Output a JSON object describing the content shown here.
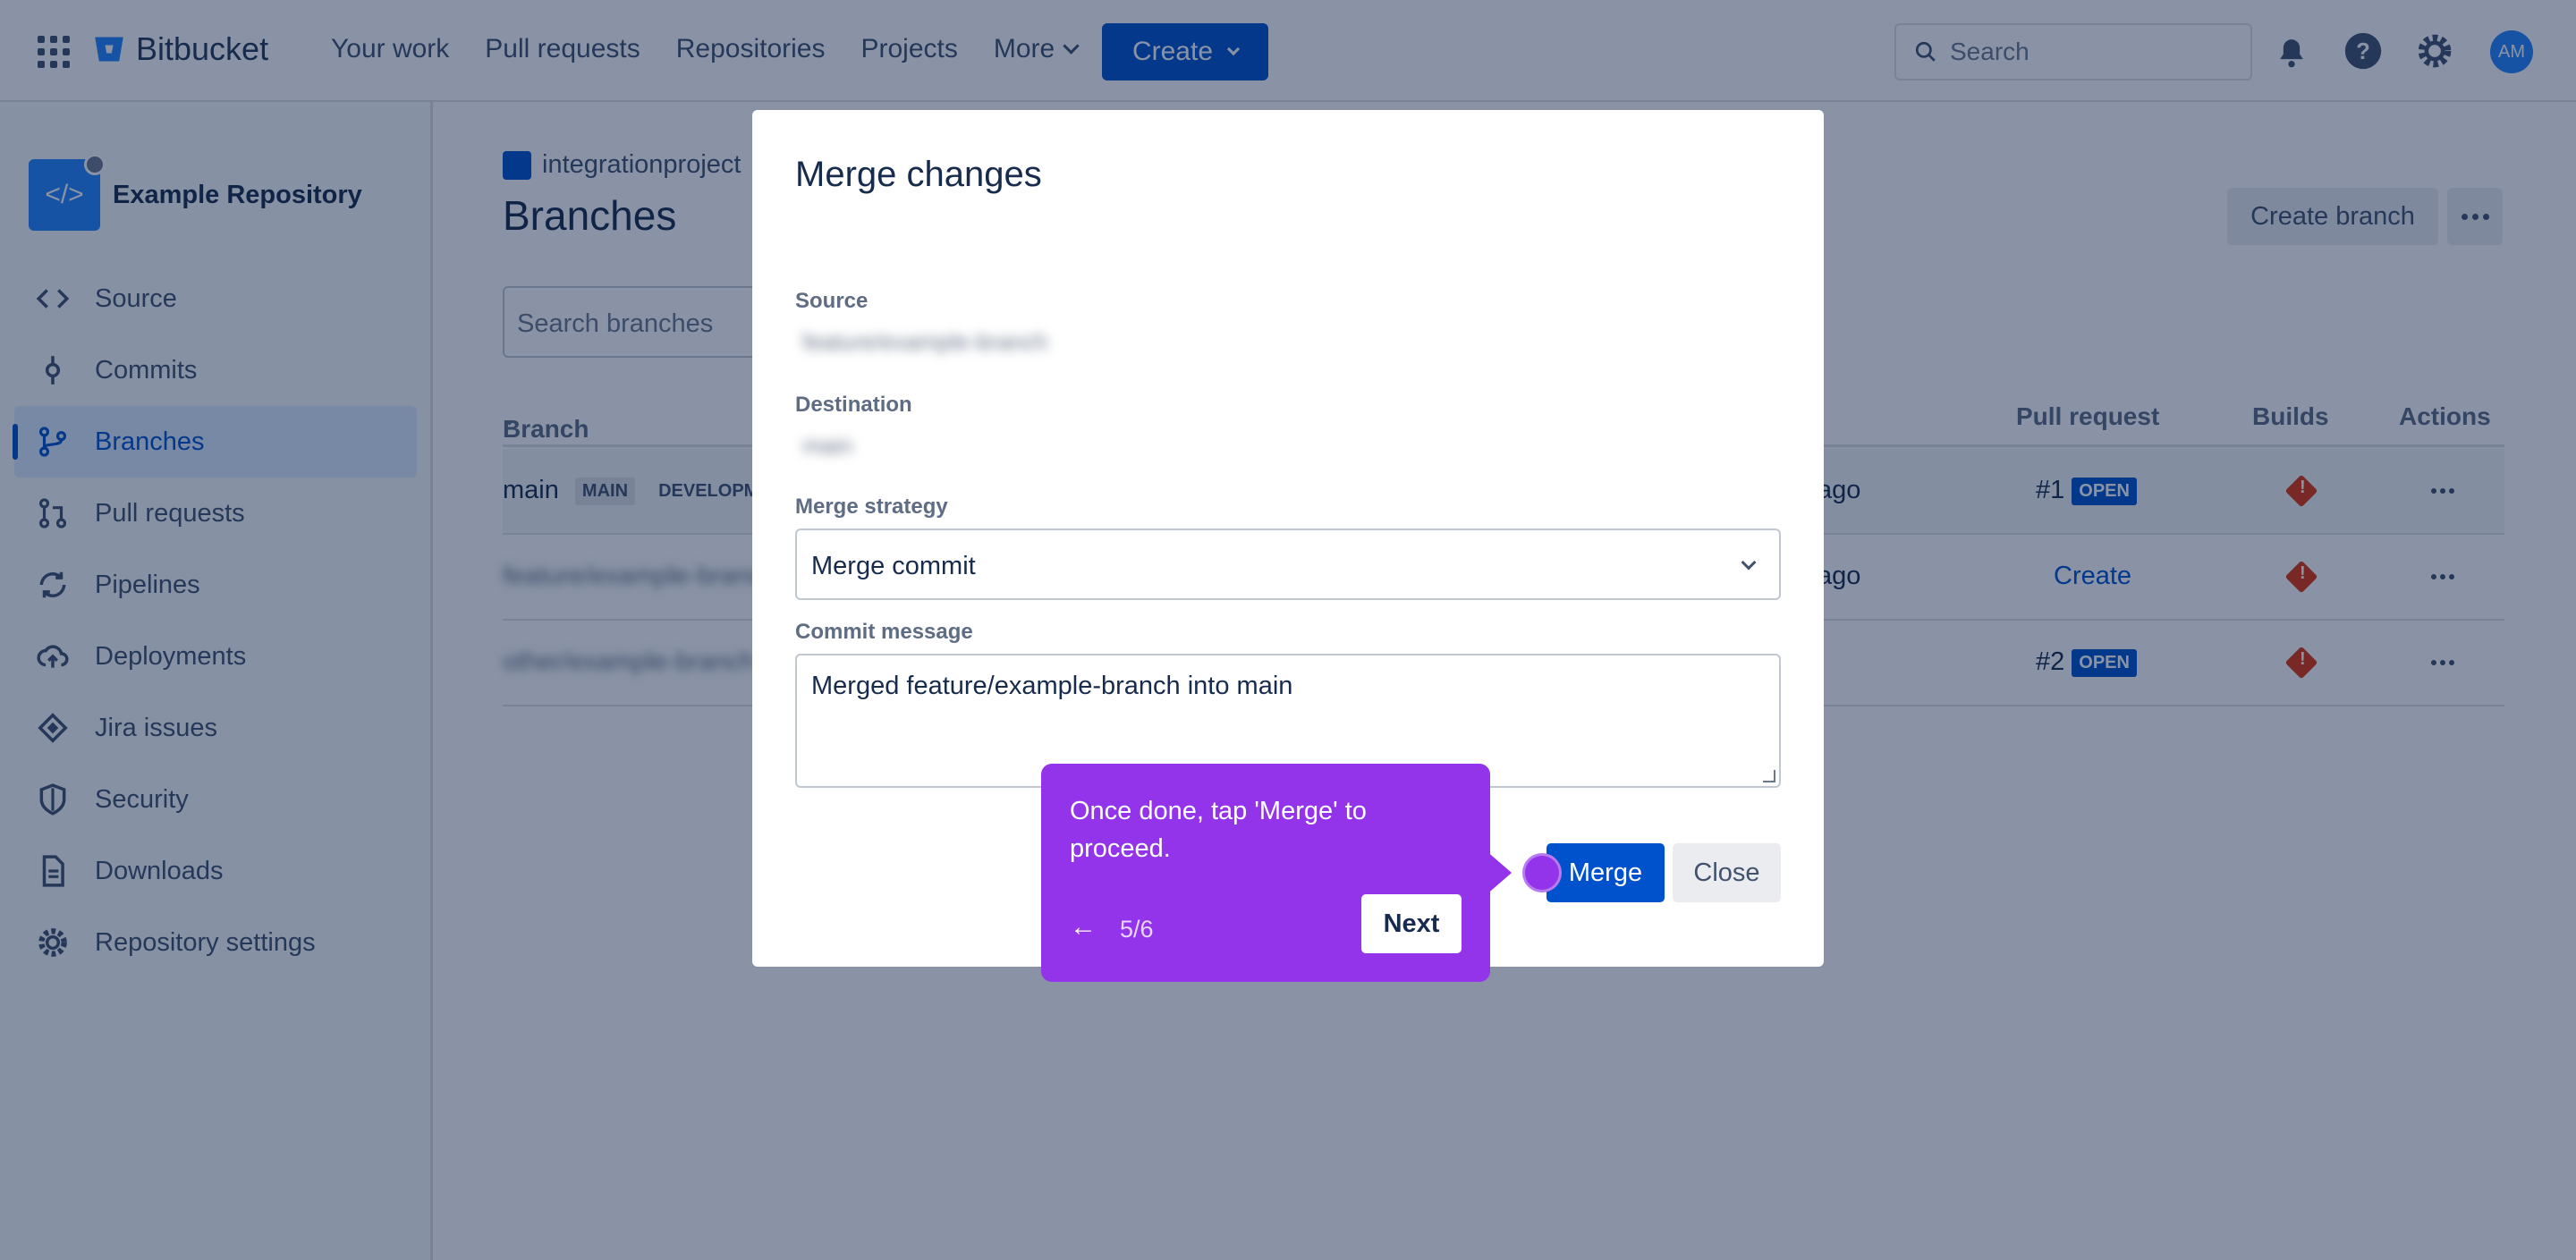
{
  "topnav": {
    "brand": "Bitbucket",
    "links": [
      "Your work",
      "Pull requests",
      "Repositories",
      "Projects"
    ],
    "more_label": "More",
    "create_label": "Create",
    "search_placeholder": "Search",
    "avatar_initials": "AM"
  },
  "sidebar": {
    "repo_name": "Example Repository",
    "items": [
      {
        "label": "Source",
        "icon": "code-icon"
      },
      {
        "label": "Commits",
        "icon": "commit-icon"
      },
      {
        "label": "Branches",
        "icon": "branch-icon",
        "active": true
      },
      {
        "label": "Pull requests",
        "icon": "pull-request-icon"
      },
      {
        "label": "Pipelines",
        "icon": "pipelines-icon"
      },
      {
        "label": "Deployments",
        "icon": "cloud-upload-icon"
      },
      {
        "label": "Jira issues",
        "icon": "jira-icon"
      },
      {
        "label": "Security",
        "icon": "shield-icon"
      },
      {
        "label": "Downloads",
        "icon": "file-icon"
      },
      {
        "label": "Repository settings",
        "icon": "gear-icon"
      }
    ]
  },
  "main": {
    "breadcrumb": "integrationproject",
    "title": "Branches",
    "create_branch_label": "Create branch",
    "search_placeholder": "Search branches",
    "columns": {
      "branch": "Branch",
      "pull_request": "Pull request",
      "builds": "Builds",
      "actions": "Actions"
    },
    "rows": [
      {
        "branch": "main",
        "lozenges": [
          "MAIN",
          "DEVELOPM"
        ],
        "updated": "ago",
        "pr_number": "#1",
        "pr_status": "OPEN"
      },
      {
        "branch": "feature/example-branch",
        "updated": "ago",
        "pr_link": "Create"
      },
      {
        "branch": "other/example-branch",
        "updated": "",
        "pr_number": "#2",
        "pr_status": "OPEN"
      }
    ]
  },
  "modal": {
    "title": "Merge changes",
    "source_label": "Source",
    "source_value": "feature/example-branch",
    "destination_label": "Destination",
    "destination_value": "main",
    "strategy_label": "Merge strategy",
    "strategy_value": "Merge commit",
    "commit_label": "Commit message",
    "commit_value": "Merged feature/example-branch into main",
    "merge_label": "Merge",
    "close_label": "Close"
  },
  "tooltip": {
    "text": "Once done, tap 'Merge' to proceed.",
    "step": "5/6",
    "next_label": "Next",
    "back_glyph": "←"
  },
  "colors": {
    "accent": "#0052cc",
    "tooltip": "#9333ea",
    "danger": "#de350b"
  }
}
